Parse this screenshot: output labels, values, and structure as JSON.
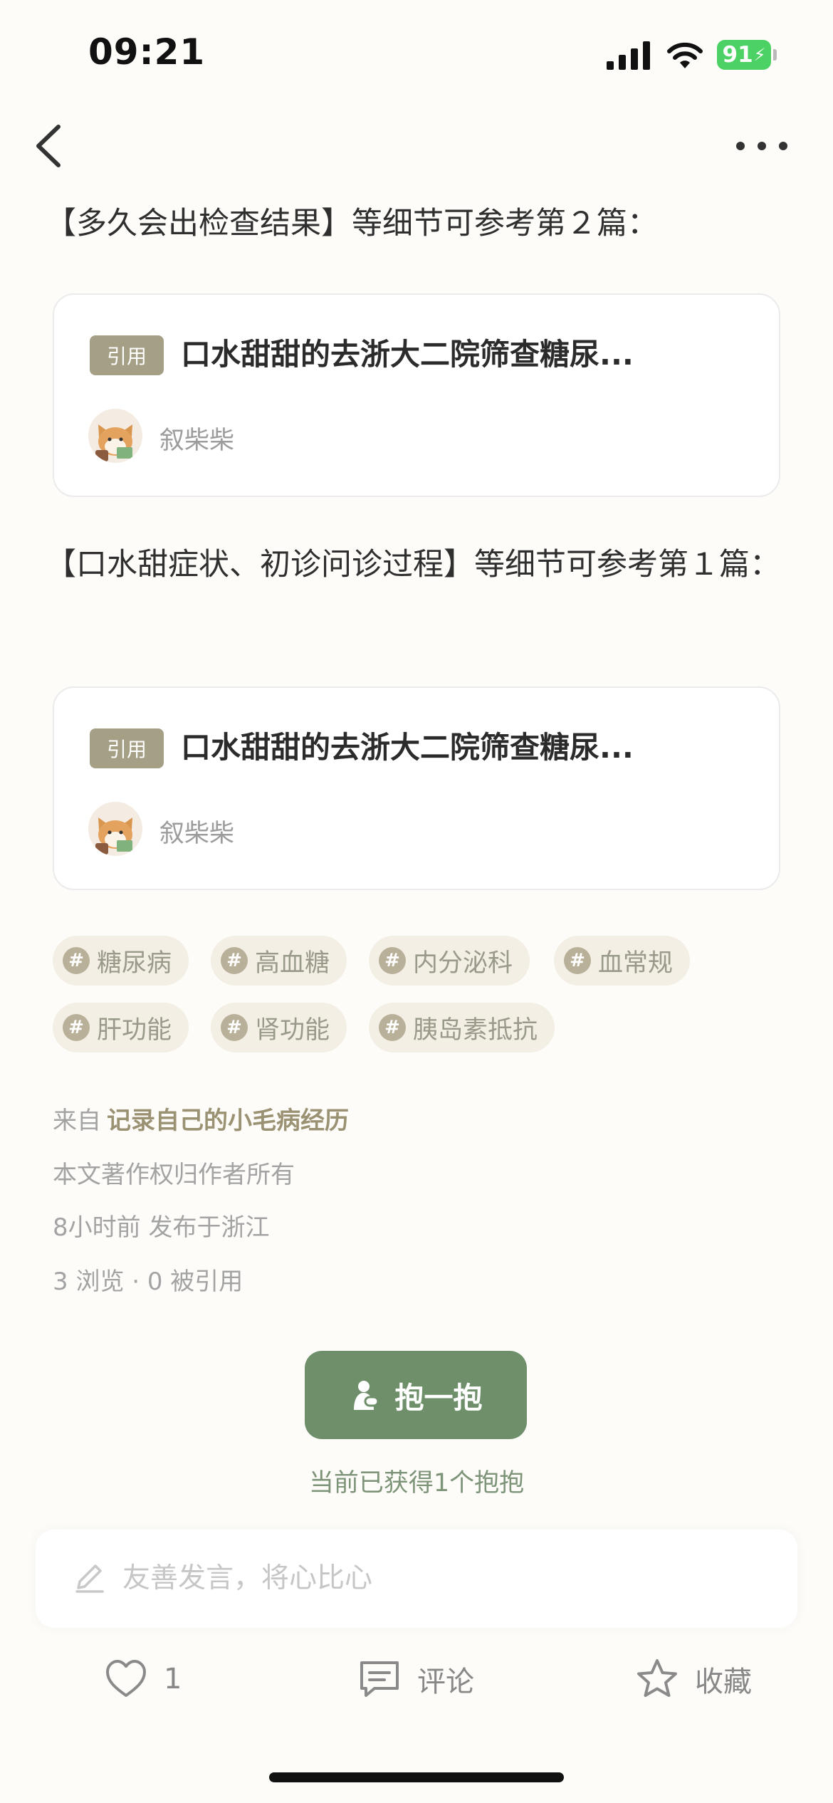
{
  "status_bar": {
    "time": "09:21",
    "battery": "91"
  },
  "nav": {
    "back_icon": "chevron-left-icon",
    "more_icon": "more-dots-icon"
  },
  "content": {
    "para1": "【多久会出检查结果】等细节可参考第２篇：",
    "para2": "【口水甜症状、初诊问诊过程】等细节可参考第１篇：",
    "citations": [
      {
        "badge": "引用",
        "title": "口水甜甜的去浙大二院筛查糖尿...",
        "author": "叙柴柴"
      },
      {
        "badge": "引用",
        "title": "口水甜甜的去浙大二院筛查糖尿...",
        "author": "叙柴柴"
      }
    ]
  },
  "tags": [
    {
      "hash": "#",
      "label": "糖尿病"
    },
    {
      "hash": "#",
      "label": "高血糖"
    },
    {
      "hash": "#",
      "label": "内分泌科"
    },
    {
      "hash": "#",
      "label": "血常规"
    },
    {
      "hash": "#",
      "label": "肝功能"
    },
    {
      "hash": "#",
      "label": "肾功能"
    },
    {
      "hash": "#",
      "label": "胰岛素抵抗"
    }
  ],
  "meta": {
    "from_prefix": "来自",
    "circle": "记录自己的小毛病经历",
    "copyright": "本文著作权归作者所有",
    "time_location": "8小时前 发布于浙江",
    "stats": "3 浏览 · 0 被引用"
  },
  "hug": {
    "button_label": "抱一抱",
    "note": "当前已获得1个抱抱"
  },
  "comment": {
    "placeholder": "友善发言，将心比心"
  },
  "actions": {
    "like_count": "1",
    "comment_label": "评论",
    "favorite_label": "收藏"
  },
  "colors": {
    "accent_green": "#6e8f6a",
    "badge": "#a59f86",
    "tag_bg": "#f3efe4",
    "battery": "#4cd264"
  }
}
